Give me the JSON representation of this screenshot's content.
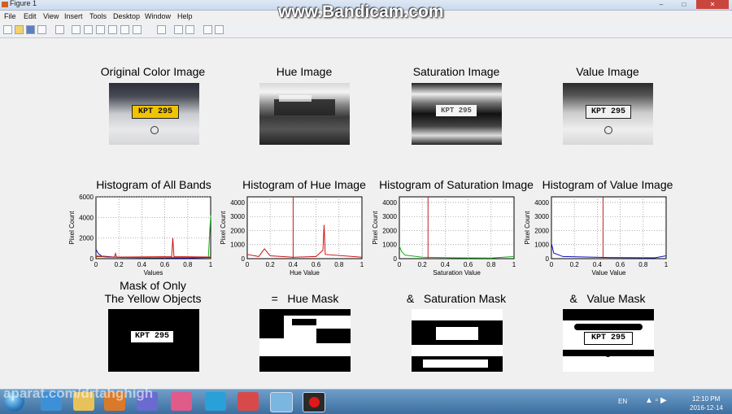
{
  "window": {
    "title": "Figure 1"
  },
  "menu": [
    "File",
    "Edit",
    "View",
    "Insert",
    "Tools",
    "Desktop",
    "Window",
    "Help"
  ],
  "watermark": "www.Bandicam.com",
  "row1_titles": [
    "Original Color Image",
    "Hue Image",
    "Saturation Image",
    "Value Image"
  ],
  "plate_text": "KPT 295",
  "plate_text_sat": "KPT 295",
  "row3": {
    "title_line1": "Mask of Only",
    "title_line2": "The Yellow Objects",
    "hue": "=   Hue Mask",
    "sat": "&   Saturation Mask",
    "val": "&   Value Mask"
  },
  "histograms": [
    {
      "title": "Histogram of All Bands",
      "ylabel": "Pixel Count",
      "xlabel": "Values",
      "yticks": [
        "0",
        "2000",
        "4000",
        "6000"
      ],
      "xticks": [
        "0",
        "0.2",
        "0.4",
        "0.6",
        "0.8",
        "1"
      ],
      "ymax": 6000,
      "threshold": null
    },
    {
      "title": "Histogram of Hue Image",
      "ylabel": "Pixel Count",
      "xlabel": "Hue Value",
      "yticks": [
        "0",
        "1000",
        "2000",
        "3000",
        "4000"
      ],
      "xticks": [
        "0",
        "0.2",
        "0.4",
        "0.6",
        "0.8",
        "1"
      ],
      "ymax": 4400,
      "threshold": 0.4
    },
    {
      "title": "Histogram of Saturation Image",
      "ylabel": "Pixel Count",
      "xlabel": "Saturation Value",
      "yticks": [
        "0",
        "1000",
        "2000",
        "3000",
        "4000"
      ],
      "xticks": [
        "0",
        "0.2",
        "0.4",
        "0.6",
        "0.8",
        "1"
      ],
      "ymax": 4400,
      "threshold": 0.25
    },
    {
      "title": "Histogram of Value Image",
      "ylabel": "Pixel Count",
      "xlabel": "Value Value",
      "yticks": [
        "0",
        "1000",
        "2000",
        "3000",
        "4000"
      ],
      "xticks": [
        "0",
        "0.2",
        "0.4",
        "0.6",
        "0.8",
        "1"
      ],
      "ymax": 4400,
      "threshold": 0.45
    }
  ],
  "colors": {
    "red": "#d01010",
    "green": "#10b010",
    "blue": "#1010c0",
    "threshold": "#c02020"
  },
  "taskbar": {
    "lang": "EN",
    "time": "12:10 PM",
    "date": "2016-12-14",
    "aparat": "aparat.com/drtahghigh"
  }
}
